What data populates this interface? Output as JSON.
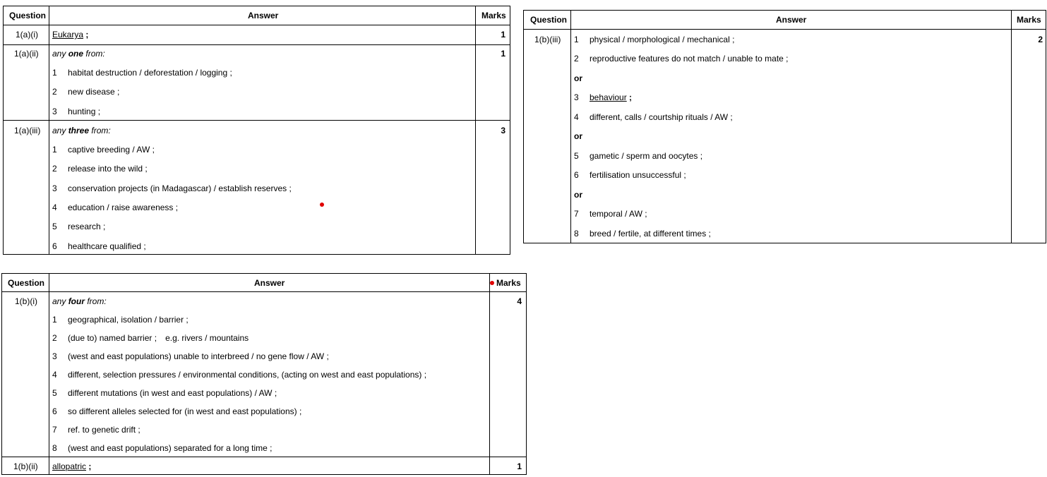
{
  "headers": {
    "question": "Question",
    "answer": "Answer",
    "marks": "Marks"
  },
  "table1": {
    "rows": [
      {
        "question": "1(a)(i)",
        "answer_term": "Eukarya",
        "answer_suffix": " ;",
        "marks": "1"
      },
      {
        "question": "1(a)(ii)",
        "intro_pre": "any ",
        "intro_key": "one",
        "intro_post": " from:",
        "marks": "1",
        "items": [
          {
            "n": "1",
            "text": "habitat destruction / deforestation / logging ;"
          },
          {
            "n": "2",
            "text": "new disease ;"
          },
          {
            "n": "3",
            "text": "hunting ;"
          }
        ]
      },
      {
        "question": "1(a)(iii)",
        "intro_pre": "any ",
        "intro_key": "three",
        "intro_post": " from:",
        "marks": "3",
        "items": [
          {
            "n": "1",
            "text": "captive breeding / AW ;"
          },
          {
            "n": "2",
            "text": "release into the wild ;"
          },
          {
            "n": "3",
            "text": "conservation projects (in Madagascar) / establish reserves ;"
          },
          {
            "n": "4",
            "text": "education / raise awareness ;"
          },
          {
            "n": "5",
            "text": "research ;"
          },
          {
            "n": "6",
            "text": "healthcare qualified ;"
          }
        ]
      }
    ]
  },
  "table2": {
    "question": "1(b)(iii)",
    "marks": "2",
    "or_label": "or",
    "items": [
      {
        "n": "1",
        "text": "physical / morphological / mechanical ;"
      },
      {
        "n": "2",
        "text": "reproductive features do not match / unable to mate ;"
      },
      {
        "n": "3",
        "text": "behaviour",
        "suffix": " ;"
      },
      {
        "n": "4",
        "text": "different, calls / courtship rituals / AW ;"
      },
      {
        "n": "5",
        "text": "gametic / sperm and oocytes ;"
      },
      {
        "n": "6",
        "text": "fertilisation unsuccessful ;"
      },
      {
        "n": "7",
        "text": "temporal / AW ;"
      },
      {
        "n": "8",
        "text": "breed / fertile, at different times ;"
      }
    ]
  },
  "table3": {
    "rows": [
      {
        "question": "1(b)(i)",
        "intro_pre": "any ",
        "intro_key": "four",
        "intro_post": " from:",
        "marks": "4",
        "items": [
          {
            "n": "1",
            "text": "geographical, isolation / barrier ;"
          },
          {
            "n": "2",
            "text": "(due to) named barrier ;",
            "extra": "e.g. rivers / mountains"
          },
          {
            "n": "3",
            "text": "(west and east populations) unable to interbreed / no gene flow / AW ;"
          },
          {
            "n": "4",
            "text": "different, selection pressures / environmental conditions, (acting on west and east populations) ;"
          },
          {
            "n": "5",
            "text": "different mutations (in west and east populations) / AW ;"
          },
          {
            "n": "6",
            "text": "so different alleles selected for (in west and east populations) ;"
          },
          {
            "n": "7",
            "text": "ref. to genetic drift ;"
          },
          {
            "n": "8",
            "text": "(west and east populations) separated for a long time ;"
          }
        ]
      },
      {
        "question": "1(b)(ii)",
        "answer_term": "allopatric",
        "answer_suffix": " ;",
        "marks": "1"
      }
    ]
  },
  "annotation_color": "#e00000"
}
